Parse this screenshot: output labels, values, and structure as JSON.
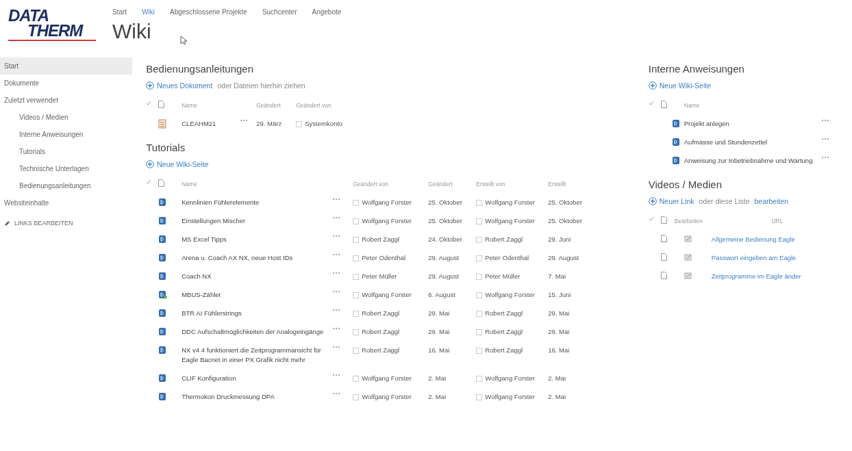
{
  "logo": {
    "line1": "DATA",
    "line2": "THERM"
  },
  "top_nav": [
    {
      "label": "Start",
      "selected": false
    },
    {
      "label": "Wiki",
      "selected": true
    },
    {
      "label": "Abgeschlossene Projekte",
      "selected": false
    },
    {
      "label": "Suchcenter",
      "selected": false
    },
    {
      "label": "Angebote",
      "selected": false
    }
  ],
  "page_title": "Wiki",
  "sidebar": {
    "items": [
      {
        "label": "Start",
        "selected": true
      },
      {
        "label": "Dokumente",
        "selected": false
      },
      {
        "label": "Zuletzt verwendet",
        "selected": false,
        "children": [
          {
            "label": "Videos / Medien",
            "selected": false
          },
          {
            "label": "Interne Anweisungen",
            "selected": false
          },
          {
            "label": "Tutorials",
            "selected": false
          },
          {
            "label": "Technische Unterlagen",
            "selected": false
          },
          {
            "label": "Bedienungsanleitungen",
            "selected": false
          }
        ]
      },
      {
        "label": "Websiteinhalte",
        "selected": false
      }
    ],
    "edit_links": "LINKS BEARBEITEN"
  },
  "bedienungsanleitungen": {
    "title": "Bedienungsanleitungen",
    "action": [
      {
        "kind": "link",
        "text": "Neues Dokument"
      },
      {
        "kind": "text",
        "text": " oder Dateien hierhin ziehen"
      }
    ],
    "columns": [
      "Name",
      "Geändert",
      "Geändert von"
    ],
    "rows": [
      {
        "name": "CLEAHM21",
        "modified": "29. März",
        "modified_by": "Systemkonto"
      }
    ]
  },
  "tutorials": {
    "title": "Tutorials",
    "action": [
      {
        "kind": "link",
        "text": "Neue Wiki-Seite"
      }
    ],
    "columns": [
      "Name",
      "Geändert von",
      "Geändert",
      "Erstellt von",
      "Erstellt"
    ],
    "rows": [
      {
        "kind": "page",
        "name": "Kennlinien Fühlerelemente",
        "modified_by": "Wolfgang Forster",
        "modified": "25. Oktober",
        "created_by": "Wolfgang Forster",
        "created": "25. Oktober"
      },
      {
        "kind": "page",
        "name": "Einstellungen Mischer",
        "modified_by": "Wolfgang Forster",
        "modified": "25. Oktober",
        "created_by": "Wolfgang Forster",
        "created": "25. Oktober"
      },
      {
        "kind": "page",
        "name": "MS Excel Tipps",
        "modified_by": "Robert Zaggl",
        "modified": "24. Oktober",
        "created_by": "Robert Zaggl",
        "created": "29. Juni"
      },
      {
        "kind": "page",
        "name": "Arena u. Coach AX NX, neue Host IDs",
        "modified_by": "Peter Odenthal",
        "modified": "29. August",
        "created_by": "Peter Odenthal",
        "created": "29. August"
      },
      {
        "kind": "page",
        "name": "Coach NX",
        "modified_by": "Peter Müller",
        "modified": "29. August",
        "created_by": "Peter Müller",
        "created": "7. Mai"
      },
      {
        "kind": "page-shared",
        "name": "MBUS-Zähler",
        "modified_by": "Wolfgang Forster",
        "modified": "6. August",
        "created_by": "Wolfgang Forster",
        "created": "15. Juni"
      },
      {
        "kind": "page",
        "name": "BTR AI Fühlerstrings",
        "modified_by": "Robert Zaggl",
        "modified": "29. Mai",
        "created_by": "Robert Zaggl",
        "created": "29. Mai"
      },
      {
        "kind": "page",
        "name": "DDC Aufschaltmöglichkeiten der Analogeingänge",
        "modified_by": "Robert Zaggl",
        "modified": "29. Mai",
        "created_by": "Robert Zaggl",
        "created": "29. Mai"
      },
      {
        "kind": "page",
        "name": "NX v4 4 funktioniert die Zeitprogrammansicht für Eagle Bacnet in einer PX Grafik nicht mehr",
        "modified_by": "Robert Zaggl",
        "modified": "16. Mai",
        "created_by": "Robert Zaggl",
        "created": "16. Mai"
      },
      {
        "kind": "page",
        "name": "CLIF Konfiguration",
        "modified_by": "Wolfgang Forster",
        "modified": "2. Mai",
        "created_by": "Wolfgang Forster",
        "created": "2. Mai"
      },
      {
        "kind": "page",
        "name": "Thermokon Druckmessung DPA",
        "modified_by": "Wolfgang Forster",
        "modified": "2. Mai",
        "created_by": "Wolfgang Forster",
        "created": "2. Mai"
      }
    ]
  },
  "interne_anweisungen": {
    "title": "Interne Anweisungen",
    "action": [
      {
        "kind": "link",
        "text": "Neue Wiki-Seite"
      }
    ],
    "columns": [
      "Name"
    ],
    "rows": [
      {
        "kind": "page",
        "name": "Projekt anlegen"
      },
      {
        "kind": "page",
        "name": "Aufmasse und Stundenzettel"
      },
      {
        "kind": "page",
        "name": "Anweisung zur Inbetriebnahme und Wartung"
      }
    ]
  },
  "videos_medien": {
    "title": "Videos / Medien",
    "action": [
      {
        "kind": "link",
        "text": "Neuer Link"
      },
      {
        "kind": "text",
        "text": " oder diese Liste "
      },
      {
        "kind": "link",
        "text": "bearbeiten"
      }
    ],
    "columns": [
      "Bearbeiten",
      "URL"
    ],
    "rows": [
      {
        "url": "Allgemeine Bedienung Eagle"
      },
      {
        "url": "Passwort eingeben am Eagle"
      },
      {
        "url": "Zeitprogramme im Eagle änder"
      }
    ]
  }
}
